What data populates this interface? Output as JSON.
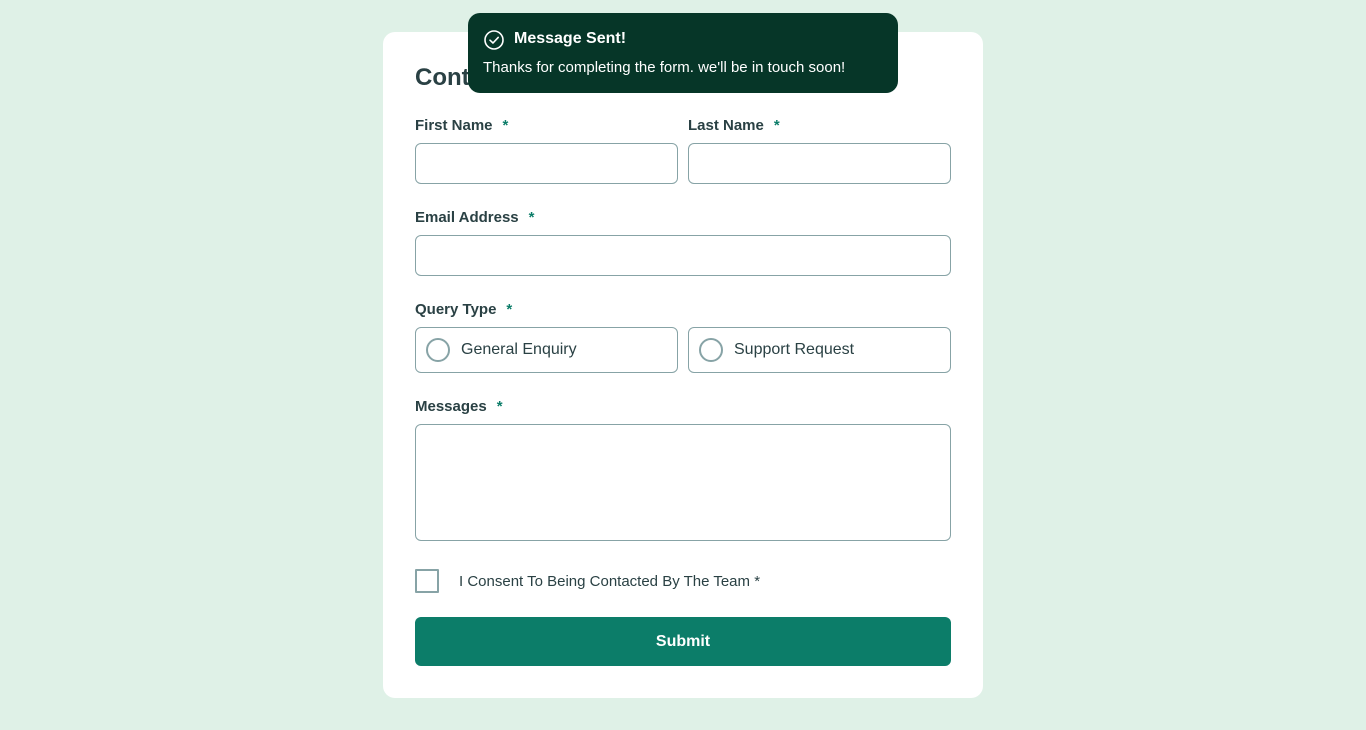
{
  "form": {
    "title": "Contact Us",
    "required_marker": "*",
    "fields": {
      "first_name": {
        "label": "First Name",
        "value": ""
      },
      "last_name": {
        "label": "Last Name",
        "value": ""
      },
      "email": {
        "label": "Email Address",
        "value": ""
      },
      "query_type": {
        "label": "Query Type",
        "options": [
          "General Enquiry",
          "Support Request"
        ],
        "selected": null
      },
      "message": {
        "label": "Messages",
        "value": ""
      }
    },
    "consent": {
      "label": "I Consent To Being Contacted By The Team",
      "marker": "*",
      "checked": false
    },
    "submit_label": "Submit"
  },
  "toast": {
    "title": "Message Sent!",
    "text": "Thanks for completing the form. we'll be in touch soon!",
    "icon": "check-circle-icon"
  },
  "colors": {
    "page_background": "#dff1e7",
    "card_background": "#ffffff",
    "accent": "#0c7d69",
    "toast_background": "#063628",
    "text": "#2a4144",
    "border": "#87a3a6"
  }
}
